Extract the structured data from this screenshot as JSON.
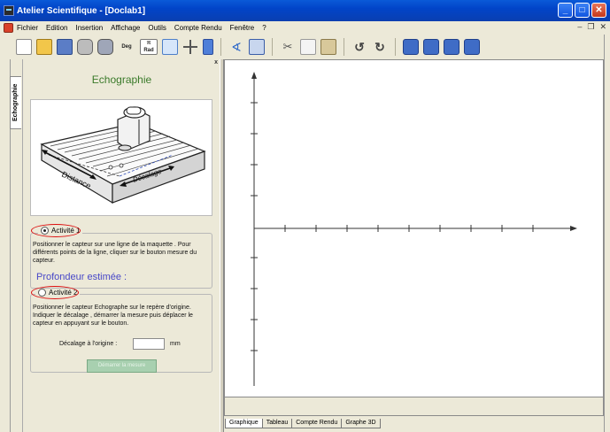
{
  "window": {
    "title": "Atelier Scientifique - [Doclab1]"
  },
  "menu": [
    "Fichier",
    "Edition",
    "Insertion",
    "Affichage",
    "Outils",
    "Compte Rendu",
    "Fenêtre",
    "?"
  ],
  "toolbar": {
    "deg_label": "Deg",
    "rad_label_top": "π",
    "rad_label_bottom": "Rad"
  },
  "side_tab": {
    "label": "Echographie"
  },
  "panel": {
    "title": "Echographie",
    "figure": {
      "distance_label": "Distance",
      "decalage_label": "Décalage"
    },
    "activity1": {
      "label": "Activité 1",
      "selected": true,
      "text": "Positionner le capteur sur une ligne de la maquette . Pour différents points de la ligne, cliquer sur le bouton mesure du capteur."
    },
    "estimated_depth": "Profondeur estimée :",
    "activity2": {
      "label": "Activité 2",
      "selected": false,
      "text": "Positionner le capteur Echographe sur le repère d'origine. Indiquer le décalage , démarrer la mesure puis déplacer le capteur en appuyant sur le  bouton."
    },
    "offset_label": "Décalage à l'origine :",
    "offset_value": "",
    "offset_unit": "mm",
    "start_button": "Démarrer la mesure"
  },
  "tabs": [
    "Graphique",
    "Tableau",
    "Compte Rendu",
    "Graphe 3D"
  ],
  "colors": {
    "title_bar": "#0144c8",
    "panel_title": "#3a7a2a",
    "depth_text": "#4848c8",
    "highlight_oval": "#dd1111"
  }
}
